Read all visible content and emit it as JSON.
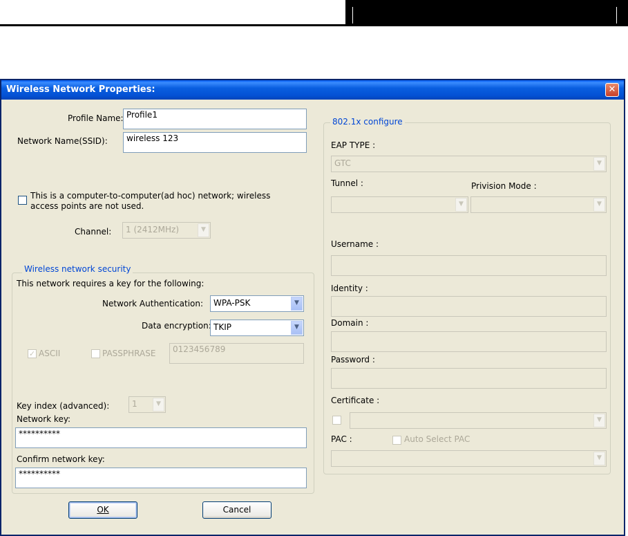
{
  "dialog": {
    "title": "Wireless Network Properties:",
    "close_glyph": "✕"
  },
  "profile": {
    "profile_name_label": "Profile Name:",
    "profile_name_value": "Profile1",
    "ssid_label": "Network Name(SSID):",
    "ssid_value": "wireless 123"
  },
  "adhoc": {
    "label_line1": "This is a computer-to-computer(ad hoc) network; wireless",
    "label_line2": "access points are not used.",
    "checked": false,
    "channel_label": "Channel:",
    "channel_value": "1  (2412MHz)"
  },
  "security": {
    "group_title": "Wireless network security",
    "intro": "This network requires a key for the following:",
    "auth_label": "Network Authentication:",
    "auth_value": "WPA-PSK",
    "encryption_label": "Data encryption:",
    "encryption_value": "TKIP",
    "ascii_label": "ASCII",
    "ascii_checked": true,
    "passphrase_label": "PASSPHRASE",
    "passphrase_value": "0123456789",
    "key_index_label": "Key index (advanced):",
    "key_index_value": "1",
    "network_key_label": "Network key:",
    "network_key_value": "**********",
    "confirm_key_label": "Confirm network key:",
    "confirm_key_value": "**********"
  },
  "eap": {
    "group_title": "802.1x configure",
    "eap_type_label": "EAP TYPE :",
    "eap_type_value": "GTC",
    "tunnel_label": "Tunnel :",
    "provision_label": "Privision Mode :",
    "username_label": "Username :",
    "identity_label": "Identity :",
    "domain_label": "Domain :",
    "password_label": "Password :",
    "certificate_label": "Certificate :",
    "pac_label": "PAC :",
    "auto_pac_label": "Auto Select PAC"
  },
  "buttons": {
    "ok_label": "OK",
    "cancel_label": "Cancel"
  },
  "icons": {
    "dropdown_arrow": "chevron-down-icon",
    "close": "close-icon"
  }
}
